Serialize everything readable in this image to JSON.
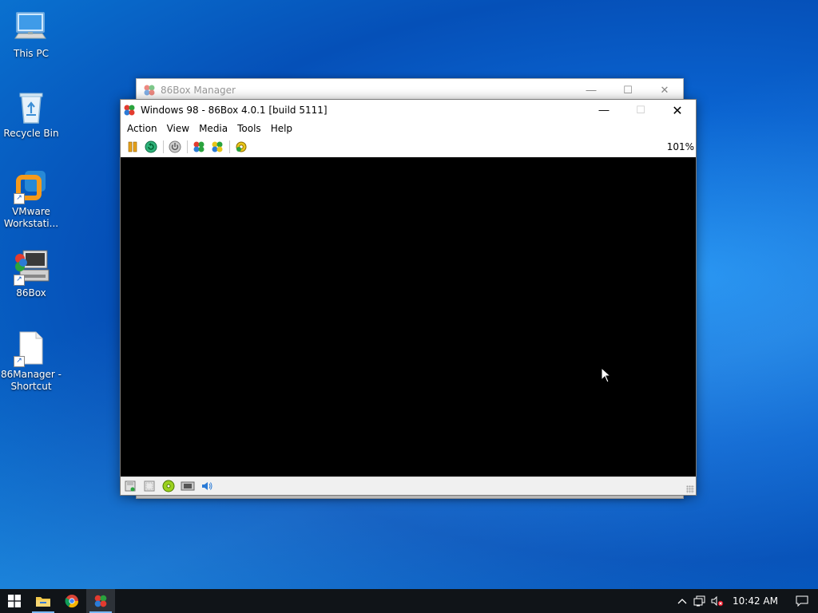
{
  "desktop": {
    "icons": [
      {
        "label": "This PC"
      },
      {
        "label": "Recycle Bin"
      },
      {
        "label": "VMware Workstati..."
      },
      {
        "label": "86Box"
      },
      {
        "label": "86Manager - Shortcut"
      }
    ]
  },
  "manager_window": {
    "title": "86Box Manager"
  },
  "vm_window": {
    "title": "Windows 98 - 86Box 4.0.1 [build 5111]",
    "menu": [
      "Action",
      "View",
      "Media",
      "Tools",
      "Help"
    ],
    "zoom": "101%",
    "toolbar_icons": [
      "pause-icon",
      "reset-icon",
      "power-icon",
      "ctrl-alt-del-icon",
      "ctrl-alt-esc-icon",
      "settings-icon"
    ],
    "status_icons": [
      "floppy-drive-icon",
      "floppy-drive-2-icon",
      "cdrom-icon",
      "network-icon",
      "sound-icon"
    ]
  },
  "taskbar": {
    "clock": "10:42 AM",
    "apps": [
      "start-icon",
      "file-explorer-icon",
      "chrome-icon",
      "86box-icon"
    ],
    "active_app": "86box-icon"
  },
  "colors": {
    "desktop_blue": "#0a63d0",
    "taskbar": "#101418",
    "screen": "#000000"
  }
}
